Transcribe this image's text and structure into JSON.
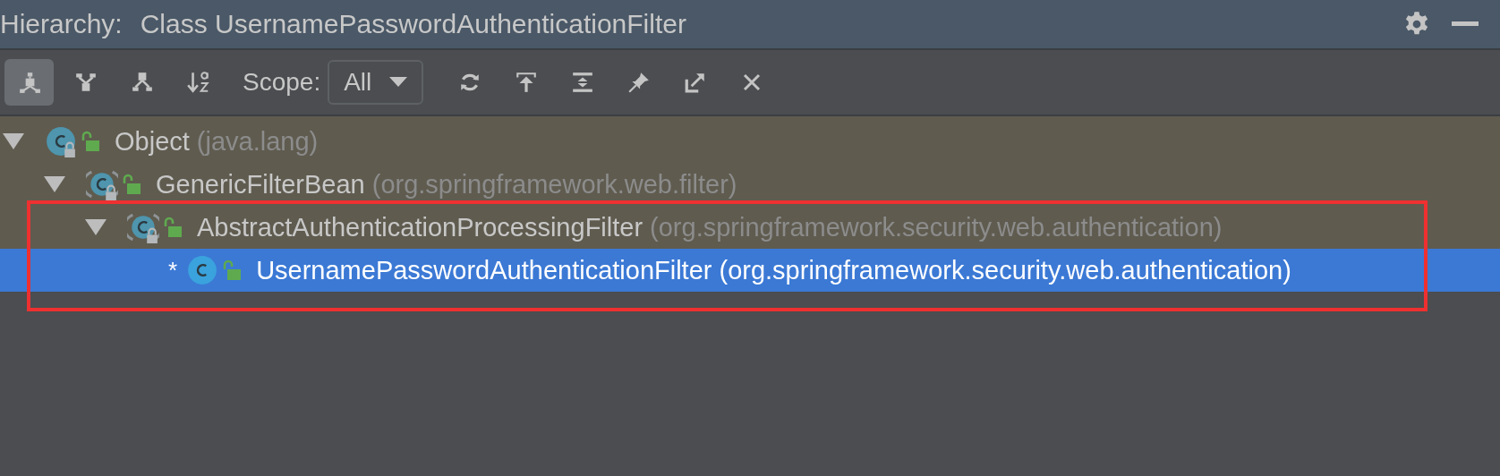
{
  "header": {
    "label": "Hierarchy:",
    "title": "Class UsernamePasswordAuthenticationFilter"
  },
  "toolbar": {
    "view_buttons": [
      {
        "kind": "subtypes",
        "selected": true
      },
      {
        "kind": "supertypes",
        "selected": false
      },
      {
        "kind": "hierarchy",
        "selected": false
      },
      {
        "kind": "sort",
        "selected": false
      }
    ],
    "scope_label": "Scope:",
    "scope_value": "All",
    "action_buttons": [
      {
        "kind": "refresh"
      },
      {
        "kind": "export"
      },
      {
        "kind": "expand"
      },
      {
        "kind": "pin"
      },
      {
        "kind": "open"
      },
      {
        "kind": "close"
      }
    ]
  },
  "tree": [
    {
      "name": "Object",
      "package": "(java.lang)",
      "abstract": false,
      "lock_badge": true,
      "expanded": true,
      "selected": false,
      "highlighted": false,
      "children": [
        {
          "name": "GenericFilterBean",
          "package": "(org.springframework.web.filter)",
          "abstract": true,
          "lock_badge": true,
          "expanded": true,
          "selected": false,
          "highlighted": false,
          "children": [
            {
              "name": "AbstractAuthenticationProcessingFilter",
              "package": "(org.springframework.security.web.authentication)",
              "abstract": true,
              "lock_badge": true,
              "expanded": true,
              "selected": false,
              "highlighted": true,
              "children": [
                {
                  "name": "UsernamePasswordAuthenticationFilter",
                  "package": "(org.springframework.security.web.authentication)",
                  "marker": "*",
                  "abstract": false,
                  "lock_badge": false,
                  "selected": true,
                  "highlighted": true
                }
              ]
            }
          ]
        }
      ]
    }
  ],
  "annotation": {
    "kind": "rectangle",
    "color": "#ee3030"
  }
}
